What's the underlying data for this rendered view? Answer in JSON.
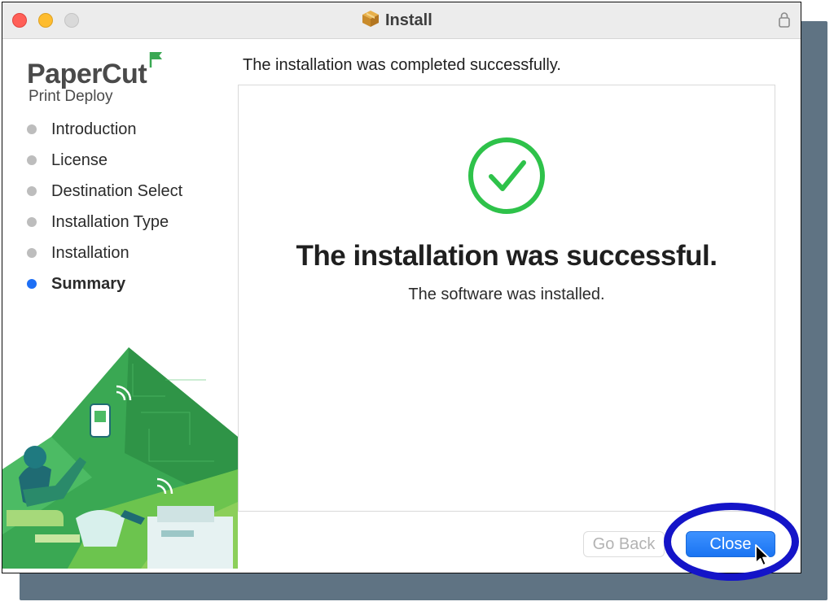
{
  "window": {
    "title": "Install"
  },
  "sidebar": {
    "logo_name": "PaperCut",
    "logo_product": "Print Deploy",
    "steps": [
      {
        "label": "Introduction",
        "current": false
      },
      {
        "label": "License",
        "current": false
      },
      {
        "label": "Destination Select",
        "current": false
      },
      {
        "label": "Installation Type",
        "current": false
      },
      {
        "label": "Installation",
        "current": false
      },
      {
        "label": "Summary",
        "current": true
      }
    ]
  },
  "content": {
    "heading": "The installation was completed successfully.",
    "success_title": "The installation was successful.",
    "success_subtitle": "The software was installed."
  },
  "footer": {
    "go_back_label": "Go Back",
    "close_label": "Close"
  },
  "colors": {
    "accent": "#1e6ff5",
    "success": "#2ec24a",
    "brand_green": "#3aa853",
    "annotation": "#1414c8"
  }
}
